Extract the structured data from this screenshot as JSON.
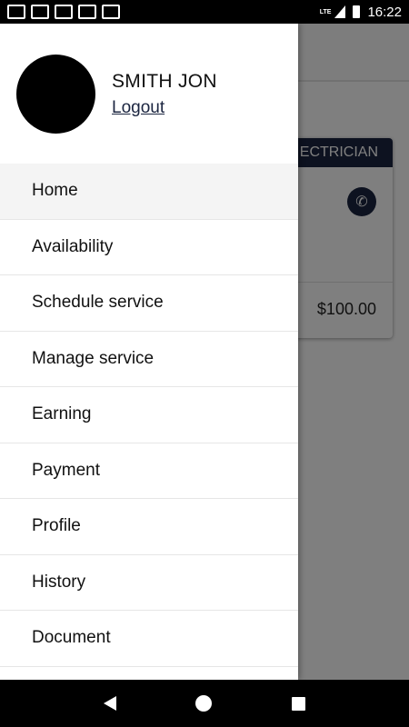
{
  "status_bar": {
    "time": "16:22",
    "network": "LTE",
    "notification_icons": [
      "gmail-icon",
      "gmail-icon",
      "news-icon",
      "news-icon",
      "maps-icon"
    ]
  },
  "background": {
    "card_header": "ECTRICIAN",
    "price": "$100.00"
  },
  "drawer": {
    "user_name": "SMITH JON",
    "logout_label": "Logout",
    "menu_items": [
      {
        "label": "Home",
        "active": true
      },
      {
        "label": "Availability"
      },
      {
        "label": "Schedule service"
      },
      {
        "label": "Manage service"
      },
      {
        "label": "Earning"
      },
      {
        "label": "Payment"
      },
      {
        "label": "Profile"
      },
      {
        "label": "History"
      },
      {
        "label": "Document"
      }
    ]
  },
  "colors": {
    "accent": "#1b2540",
    "active_item_bg": "#f4f4f4",
    "scrim": "rgba(0,0,0,0.5)"
  }
}
